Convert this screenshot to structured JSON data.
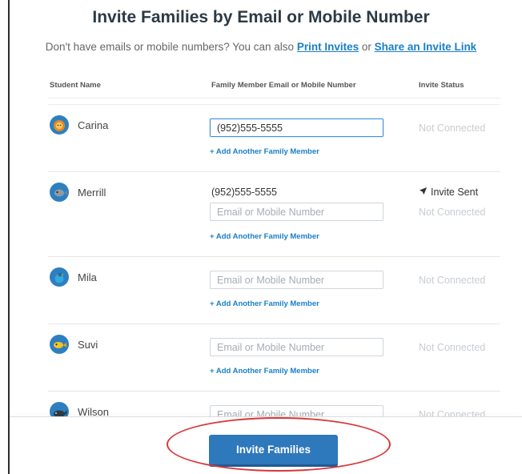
{
  "header": {
    "title": "Invite Families by Email or Mobile Number",
    "subtitle_prefix": "Don't have emails or mobile numbers? You can also",
    "print_invites": "Print Invites",
    "or_text": "or",
    "share_link": "Share an Invite Link"
  },
  "columns": {
    "student": "Student Name",
    "family": "Family Member Email or Mobile Number",
    "status": "Invite Status"
  },
  "placeholder": "Email or Mobile Number",
  "add_member": "+ Add Another Family Member",
  "status_not_connected": "Not Connected",
  "status_sent": "Invite Sent",
  "students": [
    {
      "name": "Carina",
      "value": "(952)555-5555"
    },
    {
      "name": "Merrill",
      "sent_contact": "(952)555-5555"
    },
    {
      "name": "Mila"
    },
    {
      "name": "Suvi"
    },
    {
      "name": "Wilson"
    }
  ],
  "footer": {
    "invite_button": "Invite Families"
  },
  "colors": {
    "accent": "#2e78bc",
    "link": "#1a7fc7",
    "highlight_ring": "#d8383a"
  },
  "icons": [
    "lion-avatar-icon",
    "fish-avatar-icon",
    "bird-avatar-icon",
    "fish-avatar-icon",
    "whale-avatar-icon",
    "send-arrow-icon"
  ]
}
